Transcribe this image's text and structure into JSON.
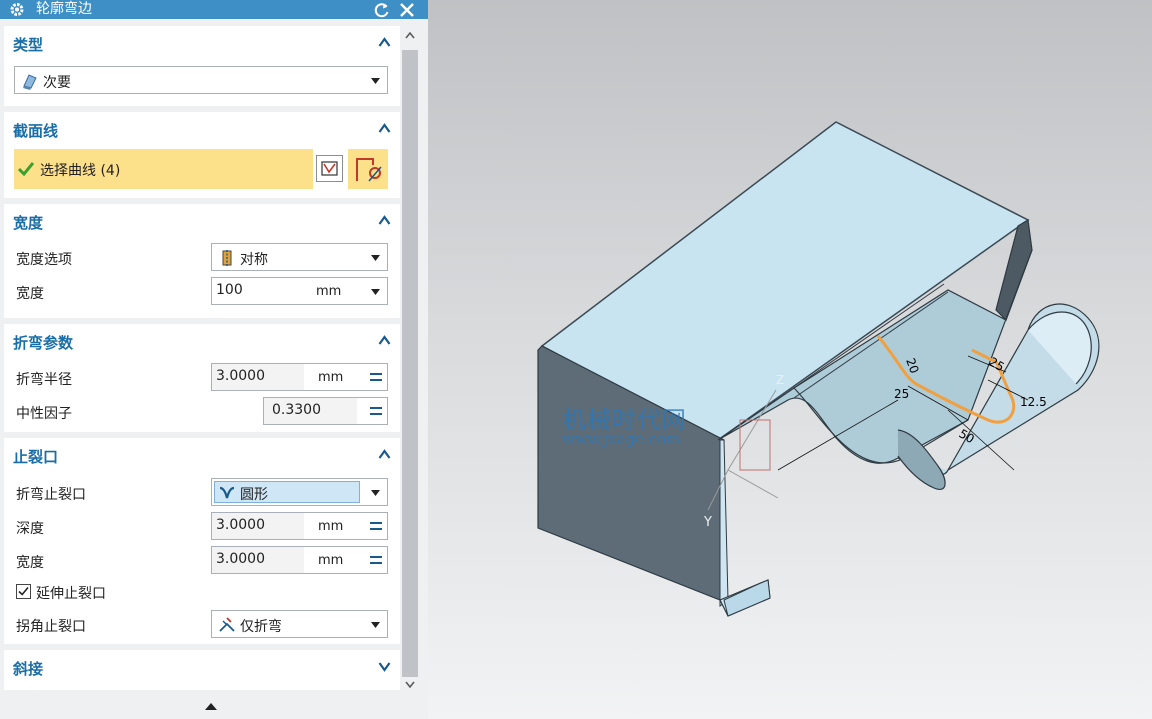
{
  "window": {
    "title": "轮廓弯边"
  },
  "sections": {
    "type": {
      "title": "类型",
      "dropdown_value": "次要"
    },
    "section_curve": {
      "title": "截面线",
      "select_label": "选择曲线 (4)"
    },
    "width": {
      "title": "宽度",
      "option_label": "宽度选项",
      "option_value": "对称",
      "width_label": "宽度",
      "width_value": "100",
      "width_unit": "mm"
    },
    "bend_params": {
      "title": "折弯参数",
      "radius_label": "折弯半径",
      "radius_value": "3.0000",
      "radius_unit": "mm",
      "kfactor_label": "中性因子",
      "kfactor_value": "0.3300"
    },
    "relief": {
      "title": "止裂口",
      "bend_relief_label": "折弯止裂口",
      "bend_relief_value": "圆形",
      "depth_label": "深度",
      "depth_value": "3.0000",
      "depth_unit": "mm",
      "width_label": "宽度",
      "width_value": "3.0000",
      "width_unit": "mm",
      "extend_label": "延伸止裂口",
      "extend_checked": true,
      "corner_label": "拐角止裂口",
      "corner_value": "仅折弯"
    },
    "miter": {
      "title": "斜接"
    }
  },
  "viewport": {
    "watermark_cn": "机械时代网",
    "watermark_url": "www.jxage.com",
    "dimensions": [
      "20",
      "25",
      "25",
      "12.5",
      "50"
    ],
    "axis_labels": [
      "Z",
      "Y"
    ]
  },
  "colors": {
    "title_bar": "#3d8fc6",
    "section_title": "#1a6ea8",
    "select_highlight": "#fde08a",
    "curve": "#f0a040"
  }
}
